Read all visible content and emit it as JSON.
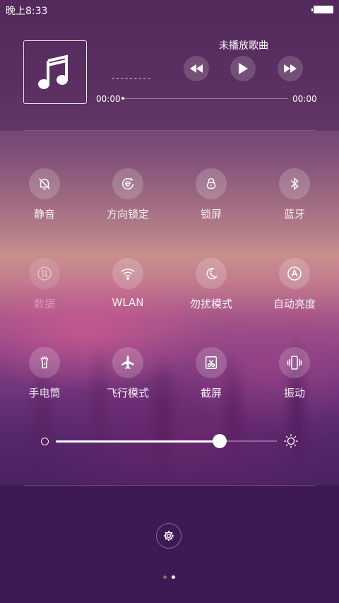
{
  "status_bar": {
    "time": "晚上8:33",
    "battery_level": 1.0
  },
  "music": {
    "title": "未播放歌曲",
    "artist_placeholder": "---------",
    "current_time": "00:00",
    "total_time": "00:00",
    "progress": 0
  },
  "toggles": [
    {
      "id": "silent",
      "label": "静音",
      "icon": "bell-off-icon",
      "active": true
    },
    {
      "id": "rotation-lock",
      "label": "方向锁定",
      "icon": "rotation-lock-icon",
      "active": true
    },
    {
      "id": "lock-screen",
      "label": "锁屏",
      "icon": "lock-icon",
      "active": true
    },
    {
      "id": "bluetooth",
      "label": "蓝牙",
      "icon": "bluetooth-icon",
      "active": true
    },
    {
      "id": "data",
      "label": "数据",
      "icon": "data-icon",
      "active": false
    },
    {
      "id": "wlan",
      "label": "WLAN",
      "icon": "wifi-icon",
      "active": true
    },
    {
      "id": "dnd",
      "label": "勿扰模式",
      "icon": "moon-icon",
      "active": true
    },
    {
      "id": "auto-brightness",
      "label": "自动亮度",
      "icon": "auto-brightness-icon",
      "active": true
    },
    {
      "id": "flashlight",
      "label": "手电筒",
      "icon": "flashlight-icon",
      "active": true
    },
    {
      "id": "airplane",
      "label": "飞行模式",
      "icon": "airplane-icon",
      "active": true
    },
    {
      "id": "screenshot",
      "label": "截屏",
      "icon": "screenshot-icon",
      "active": true
    },
    {
      "id": "vibrate",
      "label": "振动",
      "icon": "vibrate-icon",
      "active": true
    }
  ],
  "brightness": {
    "level": 0.74
  },
  "pager": {
    "pages": 2,
    "current": 2
  }
}
